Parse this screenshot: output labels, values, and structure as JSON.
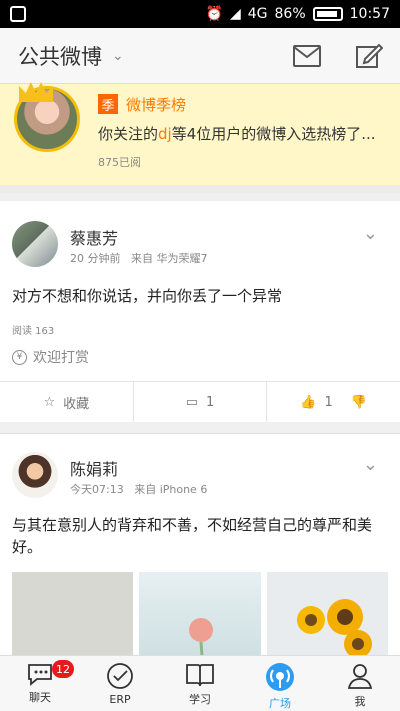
{
  "status": {
    "time": "10:57",
    "battery": "86%",
    "network": "4G"
  },
  "header": {
    "title": "公共微博"
  },
  "banner": {
    "tag": "季",
    "title": "微博季榜",
    "text_prefix": "你关注的",
    "text_highlight": "dj",
    "text_suffix": "等4位用户的微博入选热榜了...",
    "reads": "875已阅"
  },
  "posts": [
    {
      "name": "蔡惠芳",
      "time": "20 分钟前",
      "source": "来自 华为荣耀7",
      "content": "对方不想和你说话，并向你丢了一个异常",
      "reads": "阅读 163",
      "reward": "欢迎打赏",
      "fav": "收藏",
      "comments": "1",
      "likes": "1"
    },
    {
      "name": "陈娟莉",
      "time": "今天07:13",
      "source": "来自 iPhone 6",
      "content": "与其在意别人的背弃和不善，不如经营自己的尊严和美好。"
    }
  ],
  "tabs": [
    {
      "label": "聊天",
      "badge": "12"
    },
    {
      "label": "ERP"
    },
    {
      "label": "学习"
    },
    {
      "label": "广场"
    },
    {
      "label": "我"
    }
  ],
  "colors": {
    "accent": "#2d9cf0",
    "banner": "#fff7c8",
    "orange": "#ff7a00",
    "badge": "#e61a1a"
  }
}
